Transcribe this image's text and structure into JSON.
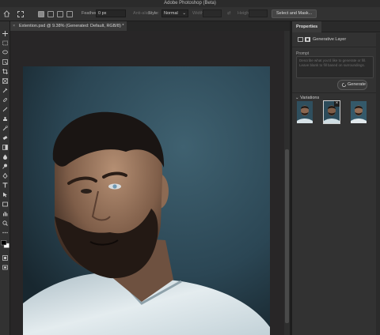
{
  "window": {
    "title": "Adobe Photoshop (Beta)"
  },
  "options_bar": {
    "feather_label": "Feather:",
    "feather_value": "0 px",
    "antialias_label": "Anti-alias",
    "style_label": "Style:",
    "style_value": "Normal",
    "width_label": "Width:",
    "height_label": "Height:",
    "select_mask_label": "Select and Mask..."
  },
  "document": {
    "tab_title": "Extention.psd @ 9.38% (Generated: Default, RGB/8) *"
  },
  "properties": {
    "tab_label": "Properties",
    "layer_type": "Generative Layer",
    "prompt_label": "Prompt",
    "prompt_placeholder": "Describe what you'd like to generate or fill. Leave blank to fill based on surroundings.",
    "generate_label": "Generate",
    "variations_label": "Variations"
  },
  "colors": {
    "panel": "#323232",
    "canvas": "#282627",
    "photo_bg": "#2c4b5a",
    "accent": "#4a8fc4"
  }
}
